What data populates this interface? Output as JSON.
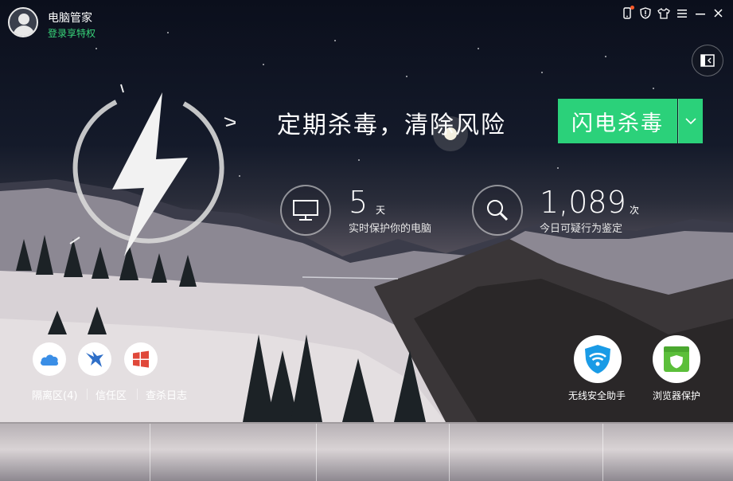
{
  "titlebar": {
    "app_name": "电脑管家",
    "login_text": "登录享特权",
    "icons": [
      "phone-icon",
      "shield-icon",
      "shirt-icon",
      "menu-icon",
      "minimize-icon",
      "close-icon"
    ]
  },
  "hero": {
    "headline": "定期杀毒，清除风险",
    "scan_button": "闪电杀毒"
  },
  "stats": {
    "protect_days": "5",
    "protect_unit": "天",
    "protect_label": "实时保护你的电脑",
    "suspicious_count": "1,089",
    "suspicious_unit": "次",
    "suspicious_label": "今日可疑行为鉴定"
  },
  "tools": {
    "quarantine": "隔离区(4)",
    "trust": "信任区",
    "log": "查杀日志"
  },
  "big_tools": {
    "wifi": "无线安全助手",
    "browser": "浏览器保护"
  },
  "colors": {
    "accent_green": "#2bd17a",
    "login_green": "#38d67a",
    "cloud_blue": "#3a8ee6",
    "wifi_blue": "#1a9be6",
    "browser_green": "#5bbf3a",
    "windows_red": "#e0483a"
  }
}
